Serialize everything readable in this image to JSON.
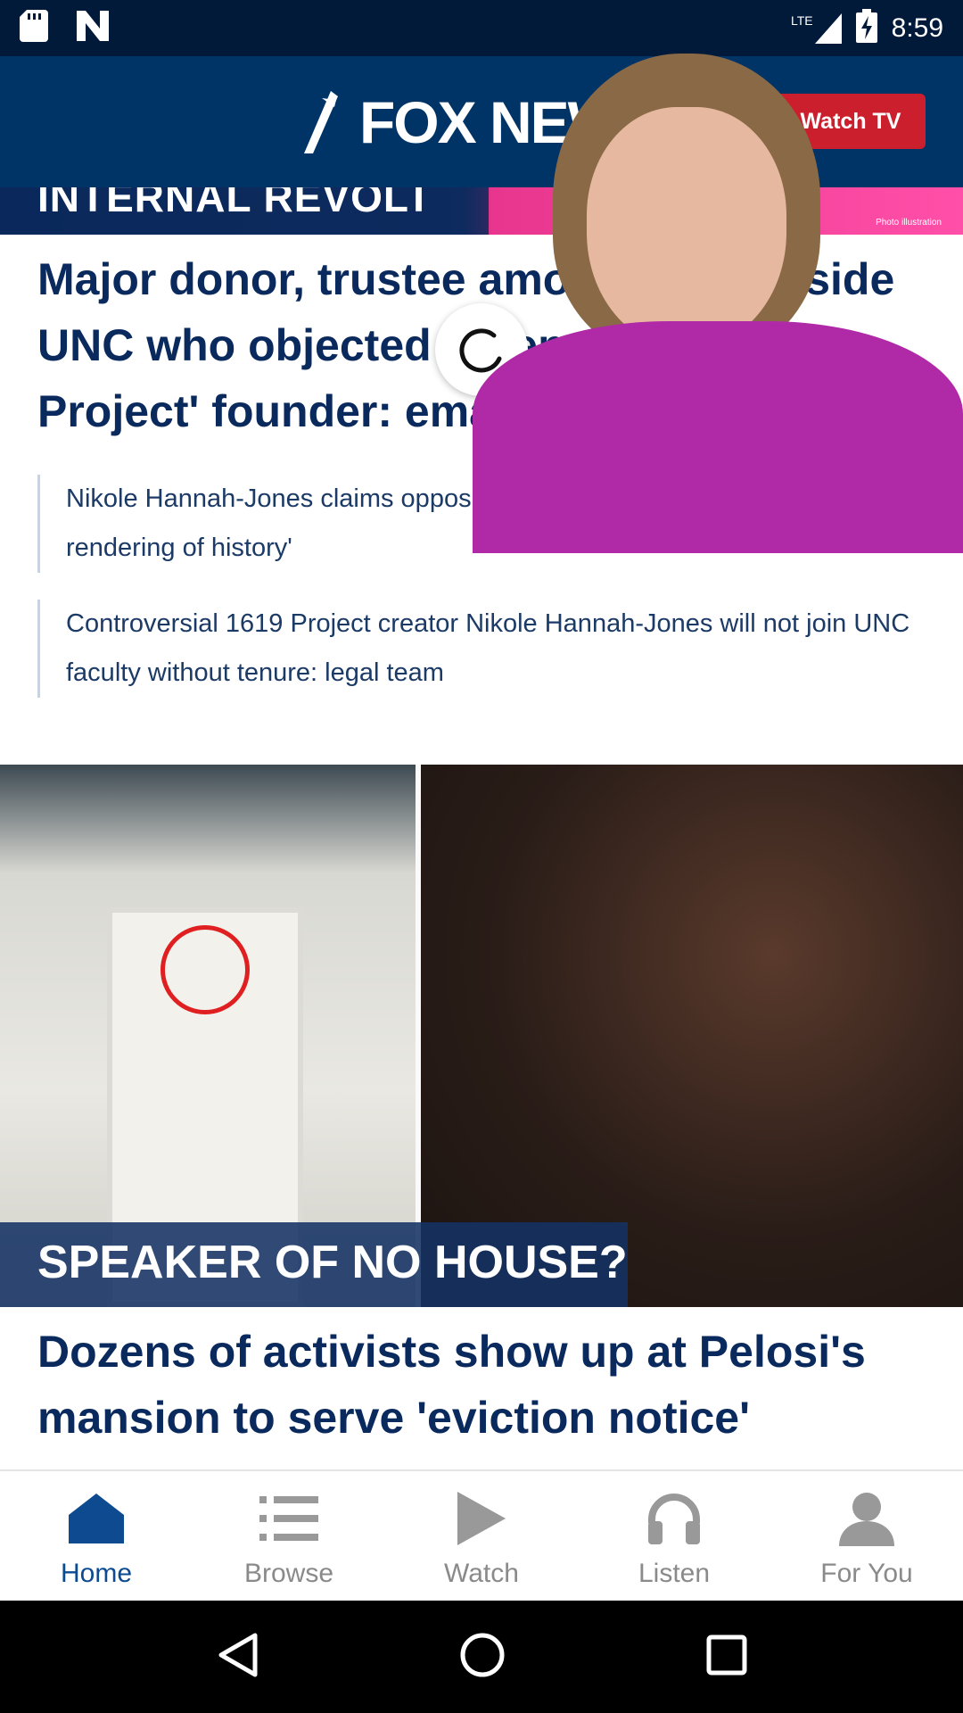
{
  "status_bar": {
    "network": "LTE",
    "time": "8:59"
  },
  "header": {
    "logo_text": "FOX NEWS",
    "watch_tv_label": "Watch TV"
  },
  "story1": {
    "kicker": "INTERNAL REVOLT",
    "photo_credit": "Photo illustration",
    "headline": "Major donor, trustee among many inside UNC who objected to tenure for '1619 Project' founder: emails",
    "related": [
      "Nikole Hannah-Jones claims opposition to 1619 project not about 'accurate rendering of history'",
      "Controversial 1619 Project creator Nikole Hannah-Jones will not join UNC faculty without tenure: legal team"
    ]
  },
  "story2": {
    "kicker": "SPEAKER OF NO HOUSE?",
    "headline": "Dozens of activists show up at Pelosi's mansion to serve 'eviction notice'"
  },
  "bottom_nav": {
    "items": [
      {
        "label": "Home",
        "icon": "home-icon",
        "active": true
      },
      {
        "label": "Browse",
        "icon": "list-icon",
        "active": false
      },
      {
        "label": "Watch",
        "icon": "play-icon",
        "active": false
      },
      {
        "label": "Listen",
        "icon": "headphones-icon",
        "active": false
      },
      {
        "label": "For You",
        "icon": "person-icon",
        "active": false
      }
    ]
  },
  "colors": {
    "header_bg": "#003366",
    "status_bg": "#011a3a",
    "accent_red": "#cc1f2d",
    "headline": "#0a2a5e",
    "nav_active": "#0d4a8f",
    "nav_inactive": "#8a8a8a"
  }
}
